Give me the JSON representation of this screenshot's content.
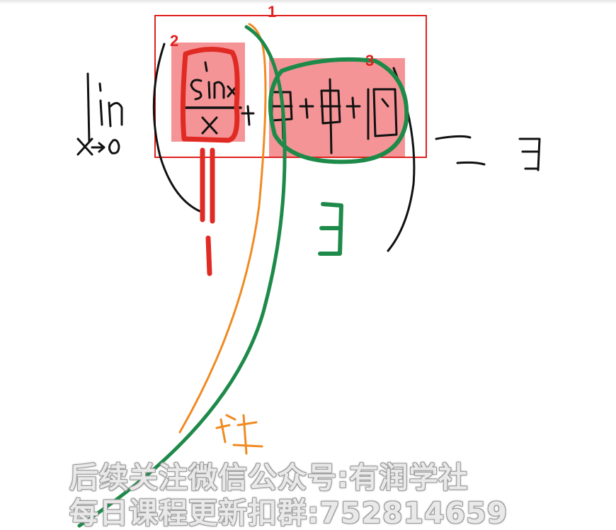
{
  "annotations": {
    "label_1": "1",
    "label_2": "2",
    "label_3": "3"
  },
  "watermark": {
    "line_1": "后续关注微信公众号:有润学社",
    "line_2": "每日课程更新扣群:752814659"
  },
  "colors": {
    "ink": "#111111",
    "red_ink": "#e02a24",
    "green_ink": "#1e8a4a",
    "orange_ink": "#f08a22",
    "highlight": "#f59496",
    "box": "#e0201e"
  }
}
